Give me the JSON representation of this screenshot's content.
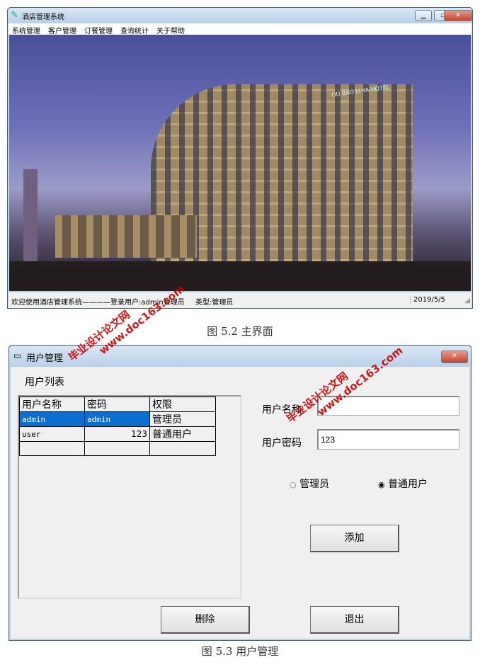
{
  "main_window": {
    "title": "酒店管理系统",
    "menu": [
      "系统管理",
      "客户管理",
      "订餐管理",
      "查询统计",
      "关于帮助"
    ],
    "status": {
      "welcome": "欢迎使用酒店管理系统————登录用户:admin管理员",
      "type": "类型:管理员",
      "date": "2019/5/5"
    },
    "hotel_sign": "OU BAO LI YA HOTEL"
  },
  "caption1": "图 5.2 主界面",
  "user_window": {
    "title": "用户管理",
    "list_label": "用户列表",
    "table": {
      "headers": [
        "用户名称",
        "密码",
        "权限"
      ],
      "rows": [
        [
          "admin",
          "admin",
          "管理员"
        ],
        [
          "user",
          "123",
          "普通用户"
        ],
        [
          "",
          "",
          ""
        ]
      ]
    },
    "username_label": "用户名称",
    "username_value": "",
    "password_label": "用户密码",
    "password_value": "123",
    "roles": [
      {
        "label": "管理员",
        "selected": false
      },
      {
        "label": "普通用户",
        "selected": true
      }
    ],
    "add": "添加",
    "delete": "删除",
    "exit": "退出"
  },
  "caption2": "图 5.3 用户管理",
  "watermark": {
    "line1": "毕业设计论文网",
    "line2": "www.doc163.com"
  },
  "colors": {
    "selection": "#0a6fcf",
    "close": "#c5452c"
  }
}
